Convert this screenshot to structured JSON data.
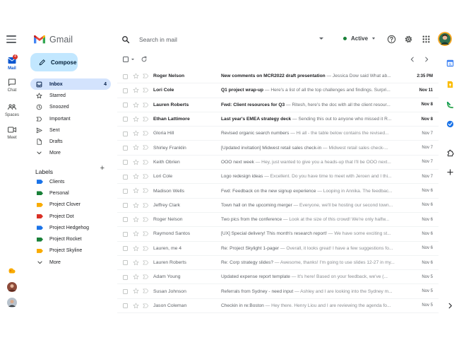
{
  "app": {
    "name": "Gmail",
    "colors": {
      "red": "#ea4335",
      "blue": "#4285f4",
      "green": "#34a853",
      "yellow": "#fbbc04",
      "accent": "#0b57d0",
      "compose_bg": "#c2e7ff",
      "active_nav_bg": "#d3e3fd",
      "status_active": "#188038"
    }
  },
  "header": {
    "menu_icon": "hamburger-icon",
    "search_placeholder": "Search in mail",
    "status_label": "Active",
    "icons": [
      "help-icon",
      "gear-icon",
      "apps-grid-icon",
      "account-avatar"
    ]
  },
  "rail": {
    "items": [
      {
        "label": "Mail",
        "icon": "mail-icon",
        "badge": "4"
      },
      {
        "label": "Chat",
        "icon": "chat-icon"
      },
      {
        "label": "Spaces",
        "icon": "spaces-icon"
      },
      {
        "label": "Meet",
        "icon": "meet-icon"
      }
    ]
  },
  "compose": {
    "label": "Compose"
  },
  "nav": {
    "items": [
      {
        "label": "Inbox",
        "icon": "inbox-icon",
        "count": "4"
      },
      {
        "label": "Starred",
        "icon": "star-icon",
        "count": ""
      },
      {
        "label": "Snoozed",
        "icon": "clock-icon",
        "count": ""
      },
      {
        "label": "Important",
        "icon": "important-icon",
        "count": ""
      },
      {
        "label": "Sent",
        "icon": "send-icon",
        "count": ""
      },
      {
        "label": "Drafts",
        "icon": "draft-icon",
        "count": ""
      },
      {
        "label": "More",
        "icon": "chevron-down-icon",
        "count": ""
      }
    ]
  },
  "labels": {
    "title": "Labels",
    "items": [
      {
        "name": "Clients",
        "color": "#1a73e8"
      },
      {
        "name": "Personal",
        "color": "#188038"
      },
      {
        "name": "Project Clover",
        "color": "#f9ab00"
      },
      {
        "name": "Project Dot",
        "color": "#d93025"
      },
      {
        "name": "Project Hedgehog",
        "color": "#1a73e8"
      },
      {
        "name": "Project Rocket",
        "color": "#188038"
      },
      {
        "name": "Project Skyline",
        "color": "#f9ab00"
      }
    ],
    "more": "More"
  },
  "mails": [
    {
      "sender": "Roger Nelson",
      "subject": "New comments on MCR2022 draft presentation",
      "snippet": " — Jessica Dow said What ab...",
      "date": "2:35 PM",
      "unread": true
    },
    {
      "sender": "Lori Cole",
      "subject": "Q1 project wrap-up",
      "snippet": " — Here's a list of all the top challenges and findings. Surpri...",
      "date": "Nov 11",
      "unread": true
    },
    {
      "sender": "Lauren Roberts",
      "subject": "Fwd: Client resources for Q3",
      "snippet": " — Ritesh, here's the doc with all the client resour...",
      "date": "Nov 8",
      "unread": true
    },
    {
      "sender": "Ethan Lattimore",
      "subject": "Last year's EMEA strategy deck",
      "snippet": " — Sending this out to anyone who missed it R...",
      "date": "Nov 8",
      "unread": true
    },
    {
      "sender": "Gloria Hill",
      "subject": "Revised organic search numbers",
      "snippet": " — Hi all - the table below contains the revised...",
      "date": "Nov 7",
      "unread": false
    },
    {
      "sender": "Shirley Franklin",
      "subject": "[Updated invitation] Midwest retail sales check-in",
      "snippet": " — Midwest retail sales check-...",
      "date": "Nov 7",
      "unread": false
    },
    {
      "sender": "Keith Obrien",
      "subject": "OOO next week",
      "snippet": " — Hey, just wanted to give you a heads-up that I'll be OOO next...",
      "date": "Nov 7",
      "unread": false
    },
    {
      "sender": "Lori Cole",
      "subject": "Logo redesign ideas",
      "snippet": " — Excellent. Do you have time to meet with Jeroen and I thi...",
      "date": "Nov 7",
      "unread": false
    },
    {
      "sender": "Madison Wells",
      "subject": "Fwd: Feedback on the new signup experience",
      "snippet": " — Looping in Annika. The feedbac...",
      "date": "Nov 6",
      "unread": false
    },
    {
      "sender": "Jeffrey Clark",
      "subject": "Town hall on the upcoming merger",
      "snippet": " — Everyone, we'll be hosting our second town...",
      "date": "Nov 6",
      "unread": false
    },
    {
      "sender": "Roger Nelson",
      "subject": "Two pics from the conference",
      "snippet": " — Look at the size of this crowd! We're only halfw...",
      "date": "Nov 6",
      "unread": false
    },
    {
      "sender": "Raymond Santos",
      "subject": "[UX] Special delivery! This month's research report!",
      "snippet": " — We have some exciting st...",
      "date": "Nov 6",
      "unread": false
    },
    {
      "sender": "Lauren, me 4",
      "subject": "Re: Project Skylight 1-pager",
      "snippet": " — Overall, it looks great! I have a few suggestions fo...",
      "date": "Nov 6",
      "unread": false
    },
    {
      "sender": "Lauren Roberts",
      "subject": "Re: Corp strategy slides?",
      "snippet": " — Awesome, thanks! I'm going to use slides 12-27 in my...",
      "date": "Nov 6",
      "unread": false
    },
    {
      "sender": "Adam Young",
      "subject": "Updated expense report template",
      "snippet": " — It's here! Based on your feedback, we've (...",
      "date": "Nov 5",
      "unread": false
    },
    {
      "sender": "Susan Johnson",
      "subject": "Referrals from Sydney - need input",
      "snippet": " — Ashley and I are looking into the Sydney m...",
      "date": "Nov 5",
      "unread": false
    },
    {
      "sender": "Jason Coleman",
      "subject": "Checkin in re:Boston",
      "snippet": " — Hey there. Henry Liou and I are reviewing the agenda fo...",
      "date": "Nov 5",
      "unread": false
    }
  ],
  "side_panel": {
    "icons": [
      "calendar-icon",
      "keep-icon",
      "tasks-icon",
      "contacts-icon",
      "addons-icon",
      "add-icon",
      "expand-panel-icon"
    ]
  }
}
